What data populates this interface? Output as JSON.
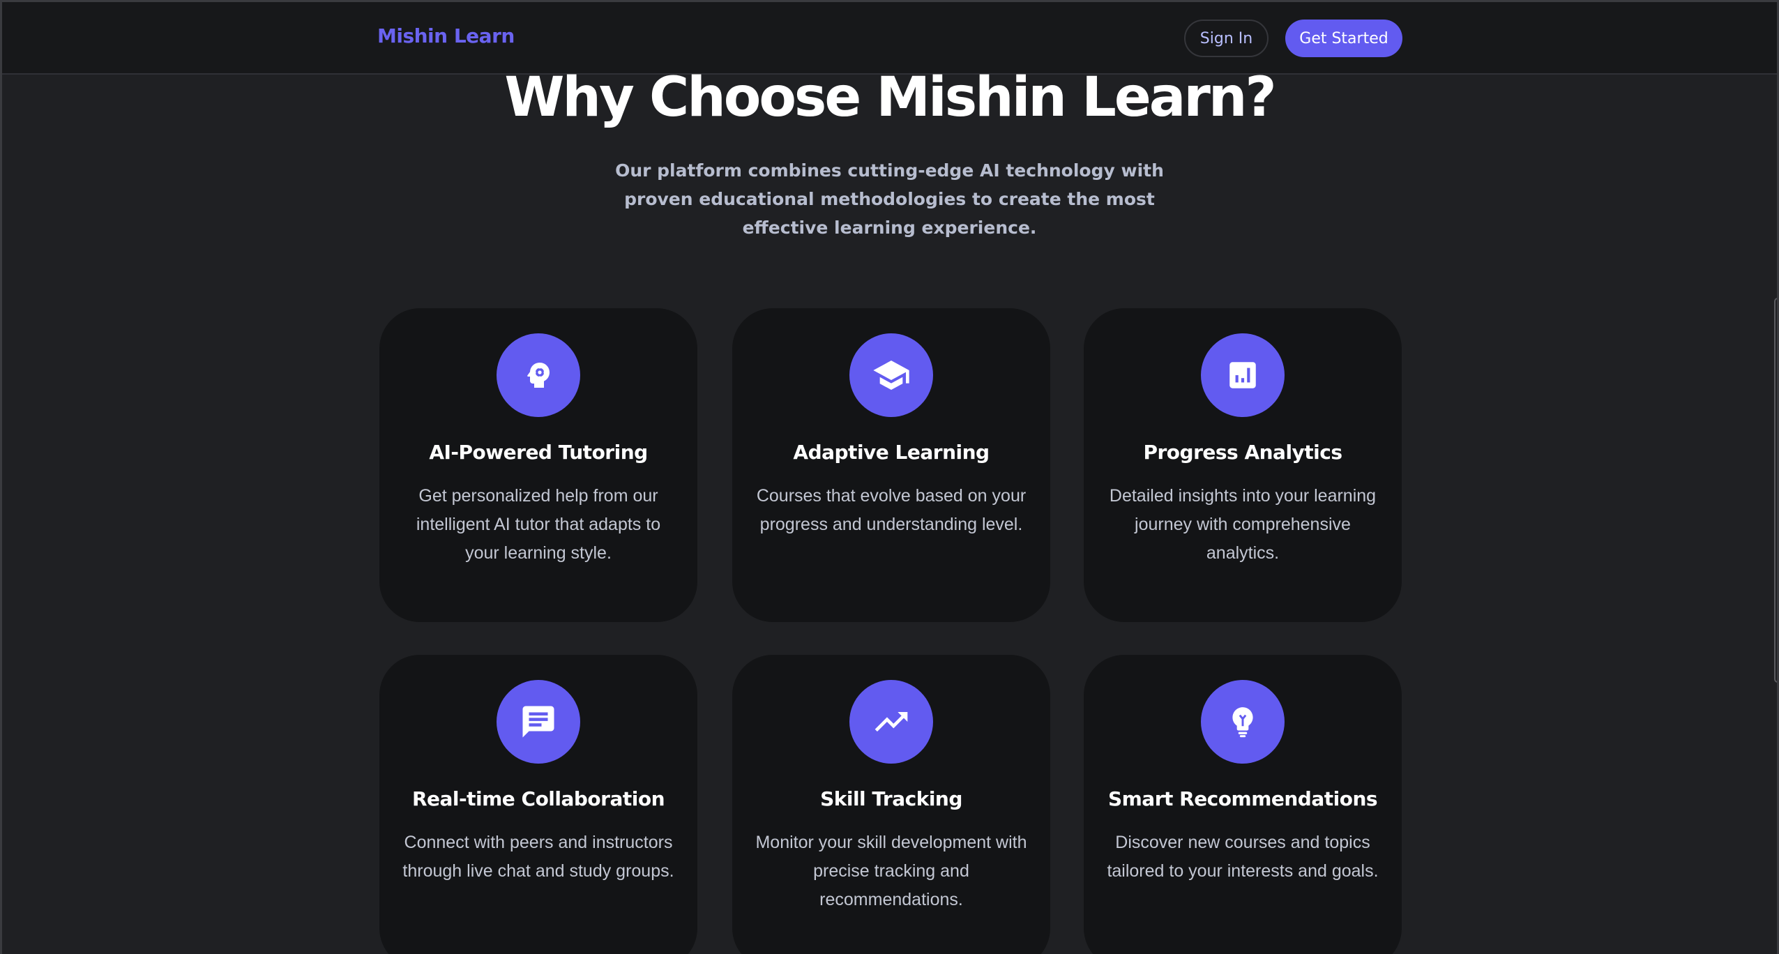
{
  "header": {
    "brand": "Mishin Learn",
    "sign_in_label": "Sign In",
    "get_started_label": "Get Started"
  },
  "hero": {
    "title": "Why Choose Mishin Learn?",
    "subtitle": "Our platform combines cutting-edge AI technology with proven educational methodologies to create the most effective learning experience."
  },
  "features": [
    {
      "icon": "brain-gear-icon",
      "title": "AI-Powered Tutoring",
      "description": "Get personalized help from our intelligent AI tutor that adapts to your learning style."
    },
    {
      "icon": "graduation-cap-icon",
      "title": "Adaptive Learning",
      "description": "Courses that evolve based on your progress and understanding level."
    },
    {
      "icon": "analytics-icon",
      "title": "Progress Analytics",
      "description": "Detailed insights into your learning journey with comprehensive analytics."
    },
    {
      "icon": "chat-icon",
      "title": "Real-time Collaboration",
      "description": "Connect with peers and instructors through live chat and study groups."
    },
    {
      "icon": "trending-up-icon",
      "title": "Skill Tracking",
      "description": "Monitor your skill development with precise tracking and recommendations."
    },
    {
      "icon": "lightbulb-icon",
      "title": "Smart Recommendations",
      "description": "Discover new courses and topics tailored to your interests and goals."
    }
  ],
  "colors": {
    "accent": "#625bf0",
    "brand": "#6a63f0",
    "background": "#1f2023",
    "card": "#131416"
  }
}
